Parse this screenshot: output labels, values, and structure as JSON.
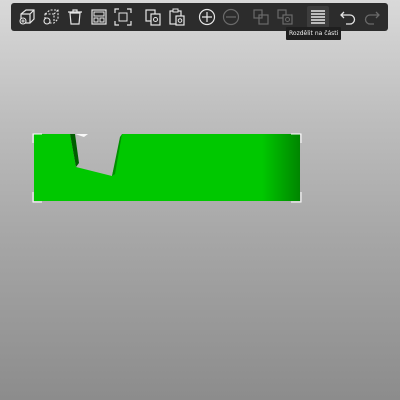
{
  "toolbar": {
    "buttons": [
      {
        "icon": "add-object-icon",
        "enabled": true
      },
      {
        "icon": "add-modifier-icon",
        "enabled": true
      },
      {
        "icon": "delete-icon",
        "enabled": true
      },
      {
        "icon": "arrange-icon",
        "enabled": true
      },
      {
        "icon": "fit-to-plate-icon",
        "enabled": true
      },
      {
        "icon": "copy-icon",
        "enabled": true
      },
      {
        "icon": "paste-icon",
        "enabled": true
      },
      {
        "icon": "add-instance-icon",
        "enabled": true
      },
      {
        "icon": "remove-instance-icon",
        "enabled": false
      },
      {
        "icon": "split-to-objects-icon",
        "enabled": false
      },
      {
        "icon": "split-to-parts-icon",
        "enabled": false
      },
      {
        "icon": "layers-editing-icon",
        "enabled": true
      },
      {
        "icon": "undo-icon",
        "enabled": true
      },
      {
        "icon": "redo-icon",
        "enabled": false
      }
    ],
    "tooltip": "Rozdělit na části"
  },
  "colors": {
    "toolbar_bg": "#2c2c2c",
    "icon_enabled": "#e6e6e6",
    "icon_disabled": "#6a6a6a",
    "model_green": "#00c800",
    "selection_white": "#ffffff"
  }
}
